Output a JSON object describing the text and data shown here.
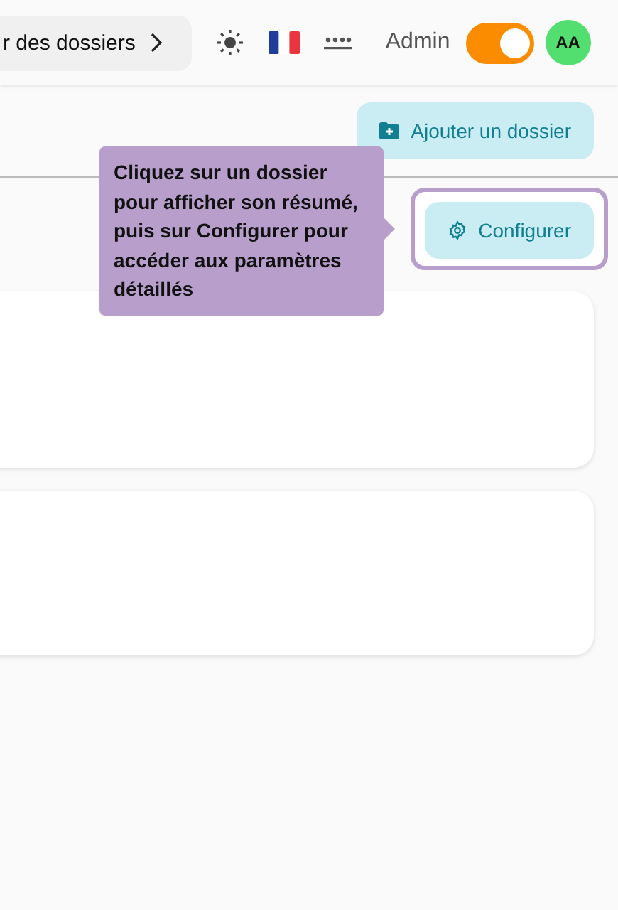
{
  "breadcrumb": {
    "label": "r des dossiers"
  },
  "header": {
    "user_label": "Admin",
    "admin_toggle": {
      "on": true
    },
    "avatar": "AA"
  },
  "toolbar": {
    "add_button": "Ajouter un dossier"
  },
  "configure_button": {
    "label": "Configurer",
    "highlighted": true
  },
  "tooltip": {
    "text": "Cliquez sur un dossier pour afficher son résumé, puis sur Configurer pour accéder aux paramètres détaillés"
  },
  "cards": [
    {
      "kind": "folder"
    },
    {
      "kind": "folder"
    }
  ]
}
